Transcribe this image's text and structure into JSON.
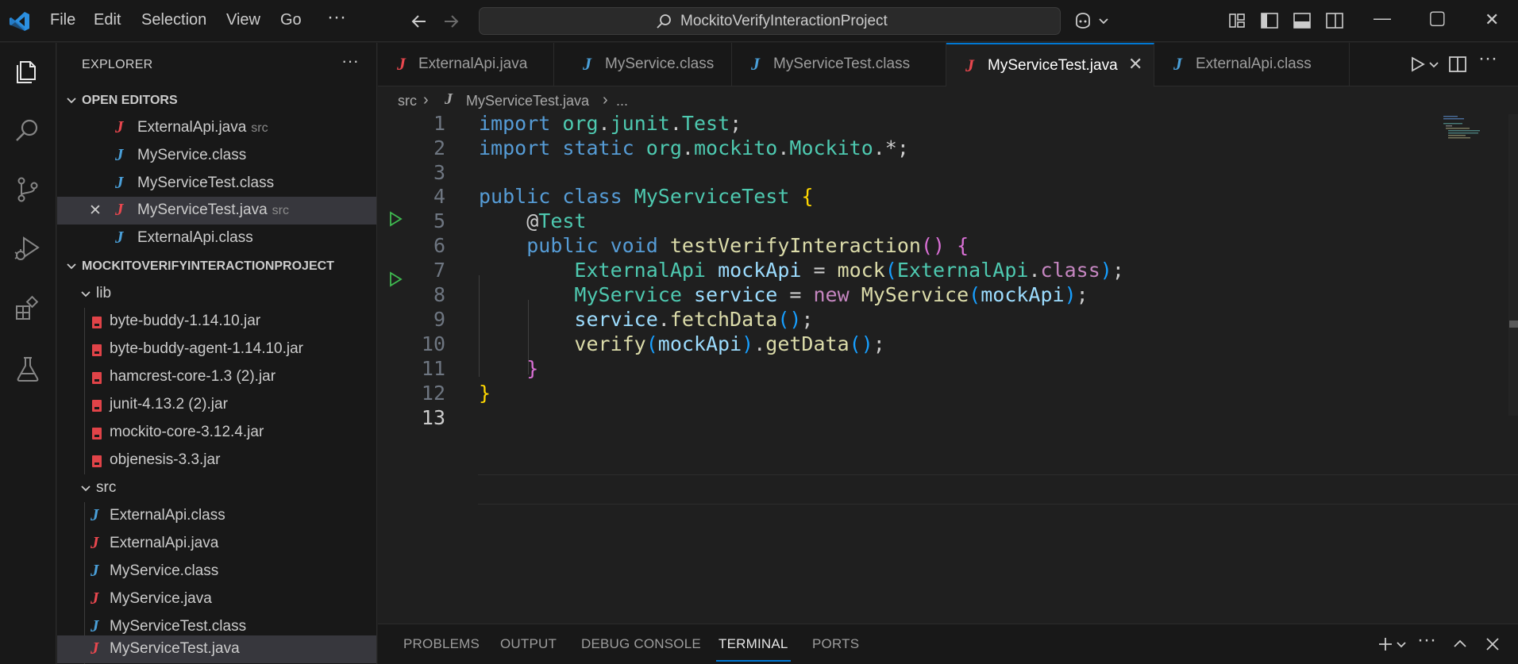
{
  "menu": {
    "items": [
      "File",
      "Edit",
      "Selection",
      "View",
      "Go"
    ],
    "more": "···"
  },
  "command_center": {
    "text": "MockitoVerifyInteractionProject"
  },
  "window_controls": {
    "minimize": "—",
    "maximize": "▢",
    "close": "✕"
  },
  "sidebar": {
    "title": "EXPLORER",
    "more": "···",
    "open_editors_header": "OPEN EDITORS",
    "open_editors": [
      {
        "name": "ExternalApi.java",
        "hint": "src",
        "kind": "java"
      },
      {
        "name": "MyService.class",
        "hint": "",
        "kind": "class"
      },
      {
        "name": "MyServiceTest.class",
        "hint": "",
        "kind": "class"
      },
      {
        "name": "MyServiceTest.java",
        "hint": "src",
        "kind": "java"
      },
      {
        "name": "ExternalApi.class",
        "hint": "",
        "kind": "class"
      }
    ],
    "project_header": "MOCKITOVERIFYINTERACTIONPROJECT",
    "lib_folder": "lib",
    "lib_items": [
      "byte-buddy-1.14.10.jar",
      "byte-buddy-agent-1.14.10.jar",
      "hamcrest-core-1.3 (2).jar",
      "junit-4.13.2 (2).jar",
      "mockito-core-3.12.4.jar",
      "objenesis-3.3.jar"
    ],
    "src_folder": "src",
    "src_items": [
      {
        "name": "ExternalApi.class",
        "kind": "class"
      },
      {
        "name": "ExternalApi.java",
        "kind": "java"
      },
      {
        "name": "MyService.class",
        "kind": "class"
      },
      {
        "name": "MyService.java",
        "kind": "java"
      },
      {
        "name": "MyServiceTest.class",
        "kind": "class"
      },
      {
        "name": "MyServiceTest.java",
        "kind": "java"
      }
    ]
  },
  "tabs": [
    {
      "label": "ExternalApi.java",
      "kind": "java"
    },
    {
      "label": "MyService.class",
      "kind": "class"
    },
    {
      "label": "MyServiceTest.class",
      "kind": "class"
    },
    {
      "label": "MyServiceTest.java",
      "kind": "java",
      "active": true
    },
    {
      "label": "ExternalApi.class",
      "kind": "class"
    }
  ],
  "breadcrumbs": {
    "folder": "src",
    "file": "MyServiceTest.java",
    "more": "..."
  },
  "editor": {
    "line_numbers": [
      "1",
      "2",
      "3",
      "4",
      "5",
      "6",
      "7",
      "8",
      "9",
      "10",
      "11",
      "12",
      "13"
    ],
    "current_line": "13"
  },
  "panel": {
    "tabs": [
      "PROBLEMS",
      "OUTPUT",
      "DEBUG CONSOLE",
      "TERMINAL",
      "PORTS"
    ],
    "active_tab": "TERMINAL"
  },
  "icons": {
    "java_glyph": "J",
    "class_glyph": "J",
    "close": "✕",
    "chevron_down": "⌄",
    "chevron_right": "›"
  },
  "colors": {
    "accent": "#0078d4",
    "java_icon": "#e8474e",
    "class_icon": "#4a9fd8",
    "jar_icon": "#e04348",
    "keyword": "#569cd6",
    "type": "#4ec9b0",
    "function": "#dcdcaa",
    "variable": "#9cdcfe"
  }
}
